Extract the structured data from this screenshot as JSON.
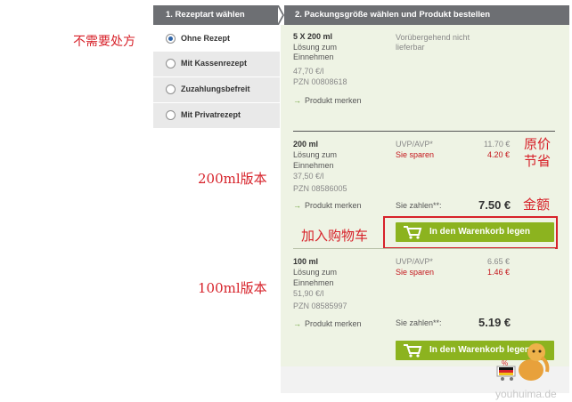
{
  "steps": {
    "step1": "1. Rezeptart wählen",
    "step2": "2. Packungsgröße wählen und Produkt bestellen"
  },
  "prescription_options": [
    {
      "label": "Ohne Rezept",
      "selected": true
    },
    {
      "label": "Mit Kassenrezept",
      "selected": false
    },
    {
      "label": "Zuzahlungsbefreit",
      "selected": false
    },
    {
      "label": "Mit Privatrezept",
      "selected": false
    }
  ],
  "products": [
    {
      "size": "5 X 200 ml",
      "form_line1": "Lösung zum",
      "form_line2": "Einnehmen",
      "unit_price": "47,70 €/l",
      "pzn": "PZN 00808618",
      "availability_line1": "Vorübergehend nicht",
      "availability_line2": "lieferbar",
      "remember": "Produkt merken"
    },
    {
      "size": "200 ml",
      "form_line1": "Lösung zum",
      "form_line2": "Einnehmen",
      "unit_price": "37,50 €/l",
      "pzn": "PZN 08586005",
      "uvp_label": "UVP/AVP*",
      "uvp_value": "11.70 €",
      "save_label": "Sie sparen",
      "save_value": "4.20 €",
      "pay_label": "Sie zahlen**:",
      "pay_value": "7.50 €",
      "remember": "Produkt merken",
      "cart_button": "In den Warenkorb legen"
    },
    {
      "size": "100 ml",
      "form_line1": "Lösung zum",
      "form_line2": "Einnehmen",
      "unit_price": "51,90 €/l",
      "pzn": "PZN 08585997",
      "uvp_label": "UVP/AVP*",
      "uvp_value": "6.65 €",
      "save_label": "Sie sparen",
      "save_value": "1.46 €",
      "pay_label": "Sie zahlen**:",
      "pay_value": "5.19 €",
      "remember": "Produkt merken",
      "cart_button": "In den Warenkorb legen"
    }
  ],
  "annotations": {
    "no_prescription": "不需要处方",
    "version_200": "200ml版本",
    "version_100": "100ml版本",
    "original_price": "原价",
    "savings": "节省",
    "amount": "金额",
    "add_to_cart": "加入购物车"
  },
  "watermark": "youhuima.de",
  "colors": {
    "header_bg": "#6d6f73",
    "panel_bg": "#eef3e4",
    "cart_button": "#8cb31f",
    "savings_red": "#c4161c",
    "annotation_red": "#d7222a",
    "radio_selected": "#2e64a8"
  }
}
